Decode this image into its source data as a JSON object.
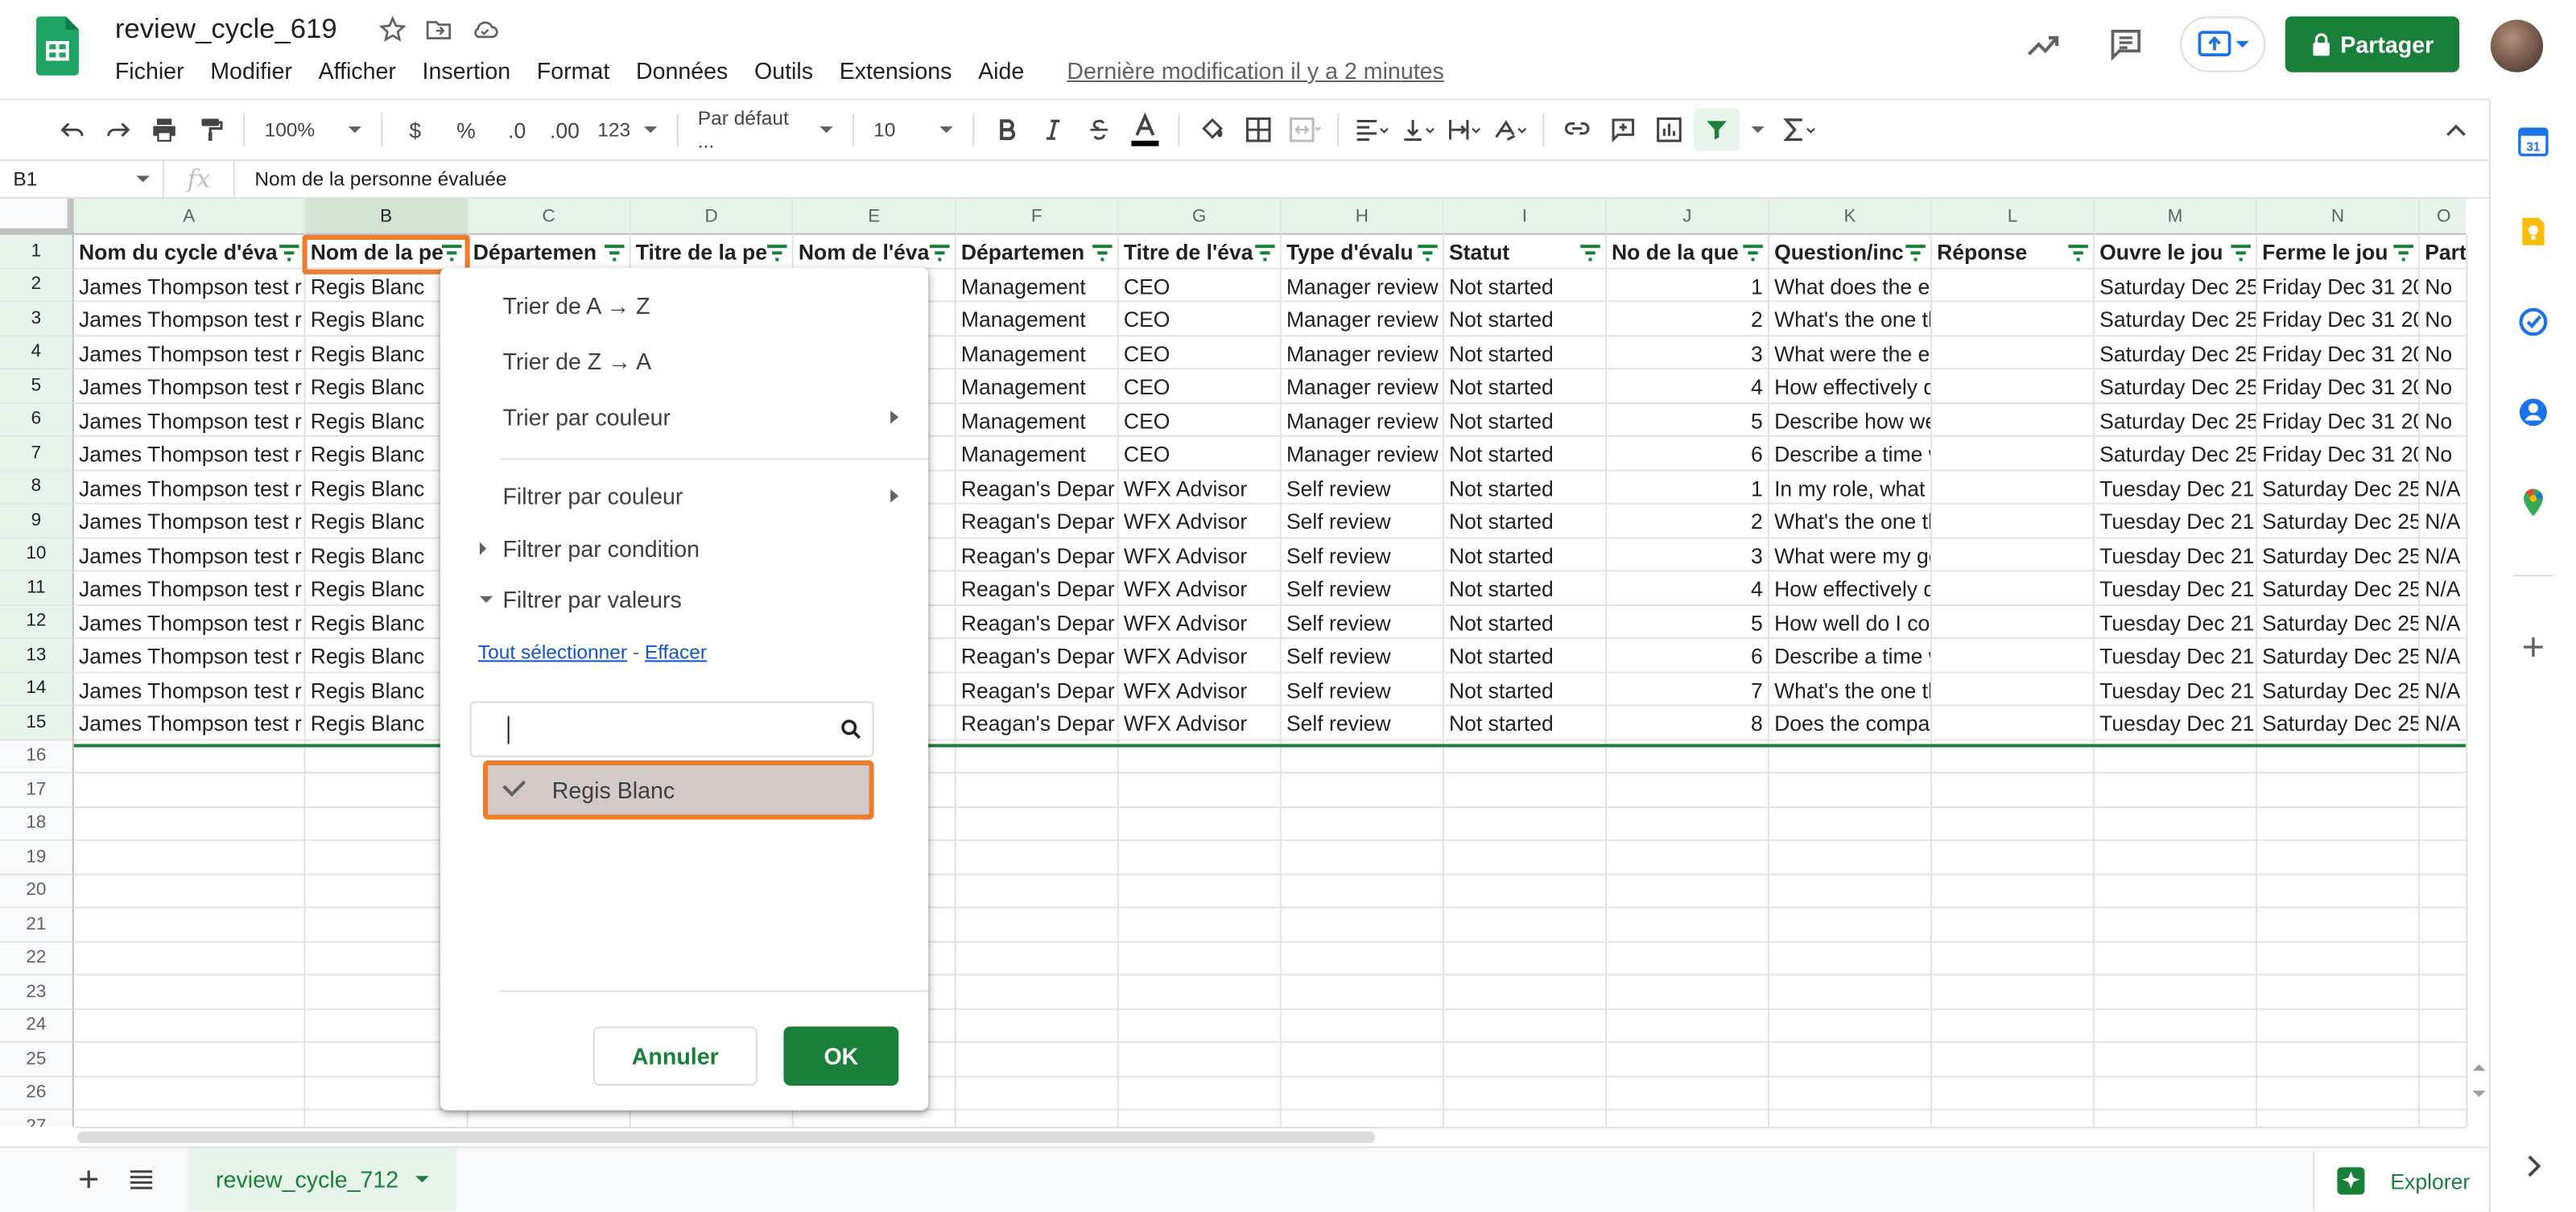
{
  "app": {
    "doc_title": "review_cycle_619",
    "last_edit": "Dernière modification il y a 2 minutes",
    "share_label": "Partager"
  },
  "menu": [
    "Fichier",
    "Modifier",
    "Afficher",
    "Insertion",
    "Format",
    "Données",
    "Outils",
    "Extensions",
    "Aide"
  ],
  "toolbar": {
    "zoom": "100%",
    "currency": "$",
    "percent": "%",
    "dec_minus": ".0",
    "dec_plus": ".00",
    "format_more": "123",
    "font": "Par défaut ...",
    "font_size": "10"
  },
  "formula_bar": {
    "cell_ref": "B1",
    "fx": "fx",
    "value": "Nom de la personne évaluée"
  },
  "grid": {
    "columns": [
      "A",
      "B",
      "C",
      "D",
      "E",
      "F",
      "G",
      "H",
      "I",
      "J",
      "K",
      "L",
      "M",
      "N",
      "O"
    ],
    "headers": [
      "Nom du cycle d'éva",
      "Nom de la pe",
      "Départemen",
      "Titre de la pe",
      "Nom de l'éva",
      "Départemen",
      "Titre de l'éva",
      "Type d'évalu",
      "Statut",
      "No de la que",
      "Question/inc",
      "Réponse",
      "Ouvre le jou",
      "Ferme le jou",
      "Part"
    ],
    "rows": [
      [
        "James Thompson test r",
        "Regis Blanc",
        "",
        "",
        "",
        "Management",
        "CEO",
        "Manager review",
        "Not started",
        "1",
        "What does the employee do well?",
        "",
        "Saturday Dec 25",
        "Friday Dec 31 20",
        "No"
      ],
      [
        "James Thompson test r",
        "Regis Blanc",
        "",
        "",
        "",
        "Management",
        "CEO",
        "Manager review",
        "Not started",
        "2",
        "What's the one thing the employe",
        "",
        "Saturday Dec 25",
        "Friday Dec 31 20",
        "No"
      ],
      [
        "James Thompson test r",
        "Regis Blanc",
        "",
        "",
        "",
        "Management",
        "CEO",
        "Manager review",
        "Not started",
        "3",
        "What were the employee's goals a",
        "",
        "Saturday Dec 25",
        "Friday Dec 31 20",
        "No"
      ],
      [
        "James Thompson test r",
        "Regis Blanc",
        "",
        "",
        "",
        "Management",
        "CEO",
        "Manager review",
        "Not started",
        "4",
        "How effectively does the employe",
        "",
        "Saturday Dec 25",
        "Friday Dec 31 20",
        "No"
      ],
      [
        "James Thompson test r",
        "Regis Blanc",
        "",
        "",
        "",
        "Management",
        "CEO",
        "Manager review",
        "Not started",
        "5",
        "Describe how well the employee c",
        "",
        "Saturday Dec 25",
        "Friday Dec 31 20",
        "No"
      ],
      [
        "James Thompson test r",
        "Regis Blanc",
        "",
        "",
        "",
        "Management",
        "CEO",
        "Manager review",
        "Not started",
        "6",
        "Describe a time when the employ",
        "",
        "Saturday Dec 25",
        "Friday Dec 31 20",
        "No"
      ],
      [
        "James Thompson test r",
        "Regis Blanc",
        "",
        "",
        "",
        "Reagan's Depar",
        "WFX Advisor",
        "Self review",
        "Not started",
        "1",
        "In my role, what do I do well?",
        "",
        "Tuesday Dec 21",
        "Saturday Dec 25",
        "N/A"
      ],
      [
        "James Thompson test r",
        "Regis Blanc",
        "",
        "",
        "",
        "Reagan's Depar",
        "WFX Advisor",
        "Self review",
        "Not started",
        "2",
        "What's the one thing I could do to",
        "",
        "Tuesday Dec 21",
        "Saturday Dec 25",
        "N/A"
      ],
      [
        "James Thompson test r",
        "Regis Blanc",
        "",
        "",
        "",
        "Reagan's Depar",
        "WFX Advisor",
        "Self review",
        "Not started",
        "3",
        "What were my goals and to what",
        "",
        "Tuesday Dec 21",
        "Saturday Dec 25",
        "N/A"
      ],
      [
        "James Thompson test r",
        "Regis Blanc",
        "",
        "",
        "",
        "Reagan's Depar",
        "WFX Advisor",
        "Self review",
        "Not started",
        "4",
        "How effectively do I prioritize and",
        "",
        "Tuesday Dec 21",
        "Saturday Dec 25",
        "N/A"
      ],
      [
        "James Thompson test r",
        "Regis Blanc",
        "",
        "",
        "",
        "Reagan's Depar",
        "WFX Advisor",
        "Self review",
        "Not started",
        "5",
        "How well do I communicate with c",
        "",
        "Tuesday Dec 21",
        "Saturday Dec 25",
        "N/A"
      ],
      [
        "James Thompson test r",
        "Regis Blanc",
        "",
        "",
        "",
        "Reagan's Depar",
        "WFX Advisor",
        "Self review",
        "Not started",
        "6",
        "Describe a time when my work re",
        "",
        "Tuesday Dec 21",
        "Saturday Dec 25",
        "N/A"
      ],
      [
        "James Thompson test r",
        "Regis Blanc",
        "",
        "",
        "",
        "Reagan's Depar",
        "WFX Advisor",
        "Self review",
        "Not started",
        "7",
        "What's the one thing the company",
        "",
        "Tuesday Dec 21",
        "Saturday Dec 25",
        "N/A"
      ],
      [
        "James Thompson test r",
        "Regis Blanc",
        "",
        "",
        "",
        "Reagan's Depar",
        "WFX Advisor",
        "Self review",
        "Not started",
        "8",
        "Does the company recognize my",
        "",
        "Tuesday Dec 21",
        "Saturday Dec 25",
        "N/A"
      ]
    ],
    "visible_row_numbers": [
      "1",
      "2",
      "3",
      "4",
      "5",
      "6",
      "7",
      "8",
      "9",
      "10",
      "11",
      "12",
      "13",
      "14",
      "15",
      "16",
      "17",
      "18",
      "19",
      "20",
      "21",
      "22",
      "23",
      "24",
      "25",
      "26",
      "27"
    ]
  },
  "filter_menu": {
    "sort_az": "Trier de A → Z",
    "sort_za": "Trier de Z → A",
    "sort_color": "Trier par couleur",
    "filter_color": "Filtrer par couleur",
    "filter_condition": "Filtrer par condition",
    "filter_values": "Filtrer par valeurs",
    "select_all": "Tout sélectionner",
    "separator": "-",
    "clear": "Effacer",
    "search_value": "",
    "values": [
      {
        "label": "Regis Blanc",
        "checked": true
      }
    ],
    "cancel": "Annuler",
    "ok": "OK"
  },
  "bottom": {
    "sheet_tab": "review_cycle_712",
    "explore": "Explorer"
  },
  "colors": {
    "brand_green": "#188038",
    "highlight_orange": "#ef7d2f"
  }
}
